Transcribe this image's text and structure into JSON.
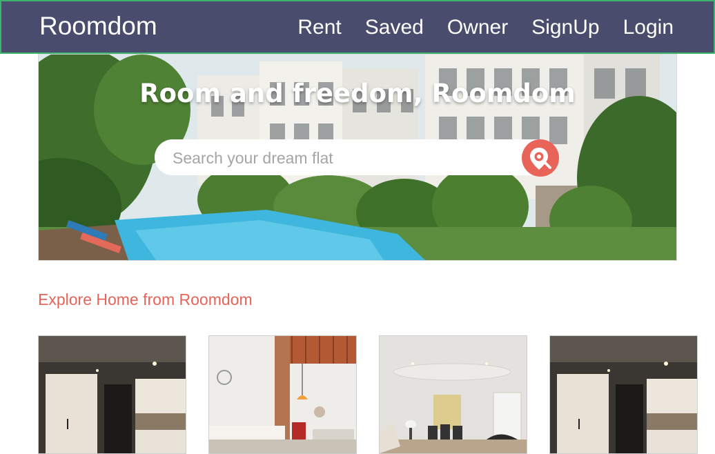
{
  "navbar": {
    "brand": "Roomdom",
    "links": [
      {
        "label": "Rent"
      },
      {
        "label": "Saved"
      },
      {
        "label": "Owner"
      },
      {
        "label": "SignUp"
      },
      {
        "label": "Login"
      }
    ]
  },
  "hero": {
    "title": "Room and freedom, Roomdom",
    "search": {
      "placeholder": "Search your dream flat",
      "value": "",
      "button_icon": "location-search-icon"
    }
  },
  "explore": {
    "title": "Explore Home from Roomdom",
    "cards": [
      {
        "image": "modern-kitchen-interior"
      },
      {
        "image": "loft-living-room-interior"
      },
      {
        "image": "bright-dining-room-interior"
      },
      {
        "image": "modern-kitchen-interior"
      }
    ]
  },
  "colors": {
    "navbar_bg": "#4a4c6d",
    "navbar_border": "#3bb36e",
    "accent": "#e86358"
  }
}
